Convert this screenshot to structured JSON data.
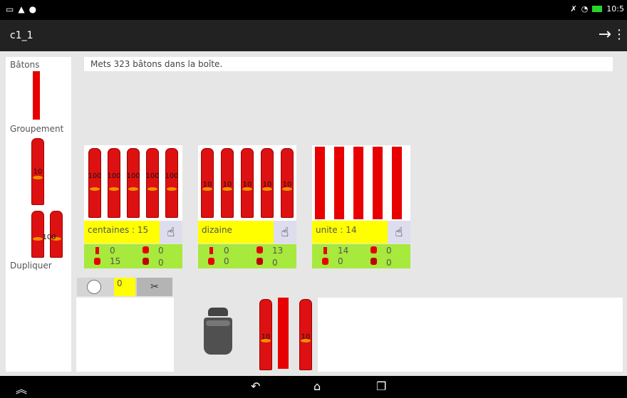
{
  "status_bar": {
    "time": "10:5"
  },
  "action_bar": {
    "title": "c1_1"
  },
  "sidebar": {
    "label_batons": "Bâtons",
    "label_groupement": "Groupement",
    "label_dupliquer": "Dupliquer",
    "groupement_bundle_label": "10",
    "dupliquer_bundle_label": "100"
  },
  "instruction": "Mets 323 bâtons dans la boîte.",
  "columns": {
    "centaines": {
      "label": "centaines : 15",
      "bundle_label": "100",
      "visible_bundles": 5,
      "count_batons": "0",
      "count_tens": "0",
      "count_hundreds": "15",
      "count_other": "0"
    },
    "dizaine": {
      "label": "dizaine",
      "bundle_label": "10",
      "visible_bundles": 5,
      "count_batons": "0",
      "count_tens": "13",
      "count_hundreds": "0",
      "count_other": "0"
    },
    "unite": {
      "label": "unite : 14",
      "visible_sticks": 5,
      "count_batons": "14",
      "count_tens": "0",
      "count_hundreds": "0",
      "count_other": "0"
    }
  },
  "toolbar": {
    "count": "0"
  },
  "workspace": {
    "bundle_label": "10"
  },
  "colors": {
    "stick_red": "#e80000",
    "label_yellow": "#ffff00",
    "counts_green": "#a7e93c"
  }
}
